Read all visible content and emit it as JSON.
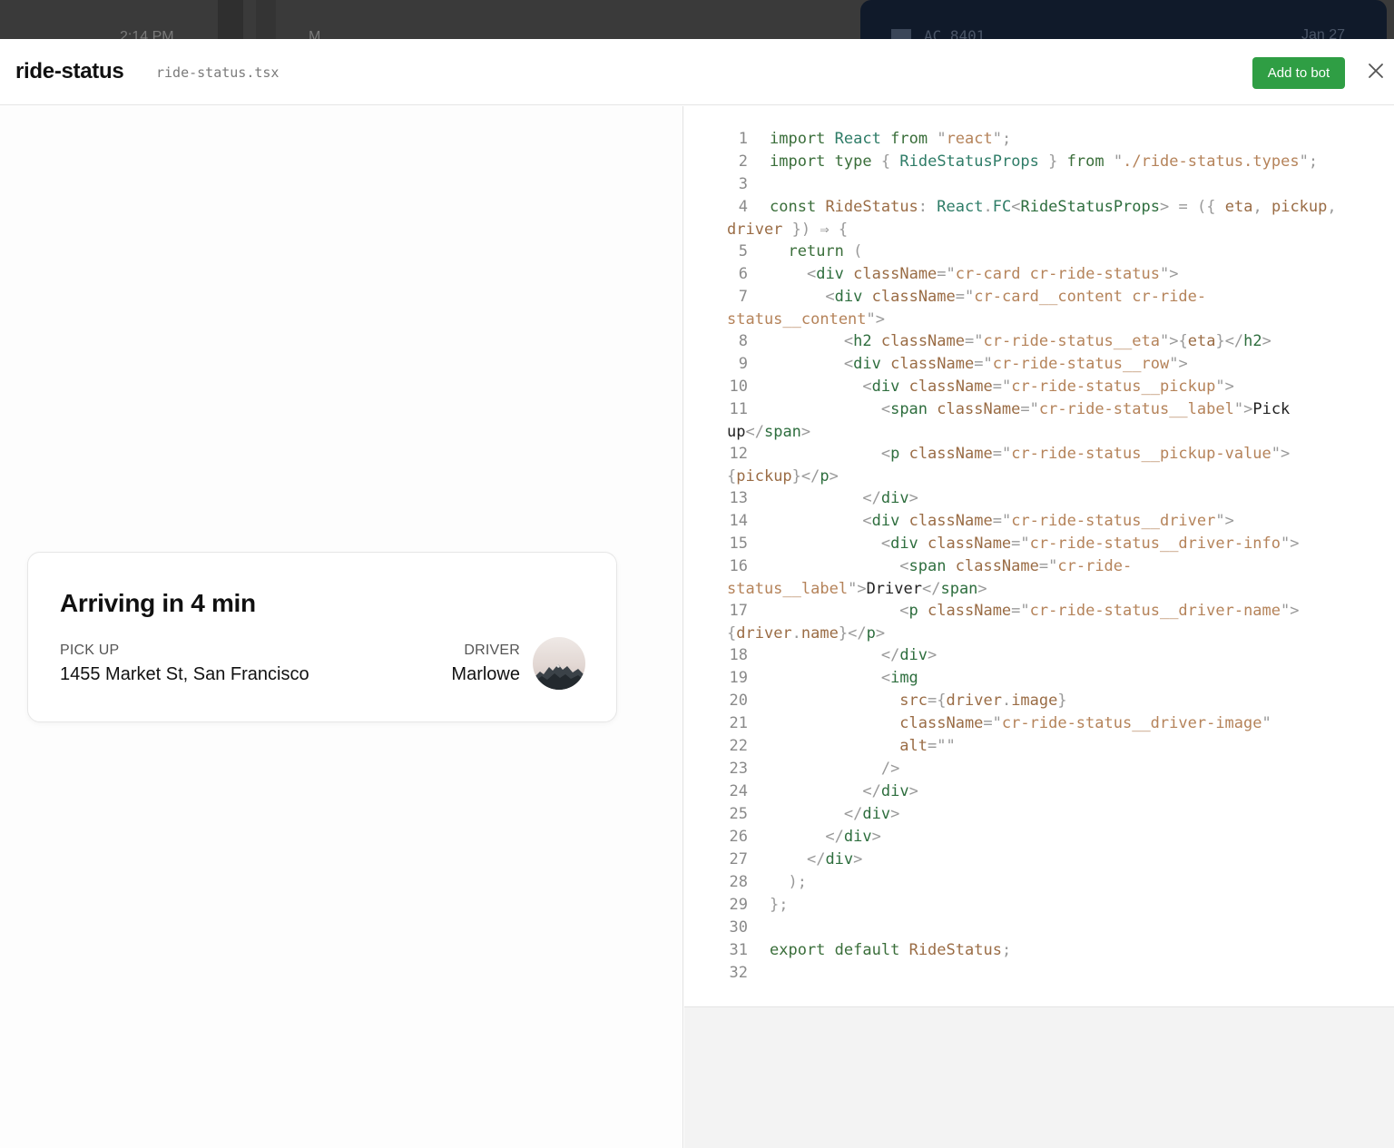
{
  "background": {
    "time_fragment": "2:14 PM",
    "m_fragment": "M",
    "card_code": "AC 8401",
    "card_right": "Jan 27"
  },
  "header": {
    "title": "ride-status",
    "filename": "ride-status.tsx",
    "add_button": "Add to bot",
    "close_icon": "close-icon"
  },
  "preview": {
    "eta": "Arriving in 4 min",
    "pickup_label": "PICK UP",
    "pickup_value": "1455 Market St, San Francisco",
    "driver_label": "DRIVER",
    "driver_name": "Marlowe"
  },
  "code": {
    "line_numbers": [
      "1",
      "2",
      "3",
      "4",
      "5",
      "6",
      "7",
      "8",
      "9",
      "10",
      "11",
      "12",
      "13",
      "14",
      "15",
      "16",
      "17",
      "18",
      "19",
      "20",
      "21",
      "22",
      "23",
      "24",
      "25",
      "26",
      "27",
      "28",
      "29",
      "30",
      "31",
      "32"
    ],
    "lines": [
      "import React from \"react\";",
      "import type { RideStatusProps } from \"./ride-status.types\";",
      "",
      "const RideStatus: React.FC<RideStatusProps> = ({ eta, pickup, driver }) ⇒ {",
      "  return (",
      "    <div className=\"cr-card cr-ride-status\">",
      "      <div className=\"cr-card__content cr-ride-status__content\">",
      "        <h2 className=\"cr-ride-status__eta\">{eta}</h2>",
      "        <div className=\"cr-ride-status__row\">",
      "          <div className=\"cr-ride-status__pickup\">",
      "            <span className=\"cr-ride-status__label\">Pick up</span>",
      "            <p className=\"cr-ride-status__pickup-value\">{pickup}</p>",
      "          </div>",
      "          <div className=\"cr-ride-status__driver\">",
      "            <div className=\"cr-ride-status__driver-info\">",
      "              <span className=\"cr-ride-status__label\">Driver</span>",
      "              <p className=\"cr-ride-status__driver-name\">{driver.name}</p>",
      "            </div>",
      "            <img",
      "              src={driver.image}",
      "              className=\"cr-ride-status__driver-image\"",
      "              alt=\"\"",
      "            />",
      "          </div>",
      "        </div>",
      "      </div>",
      "    </div>",
      "  );",
      "};",
      "",
      "export default RideStatus;",
      ""
    ]
  }
}
